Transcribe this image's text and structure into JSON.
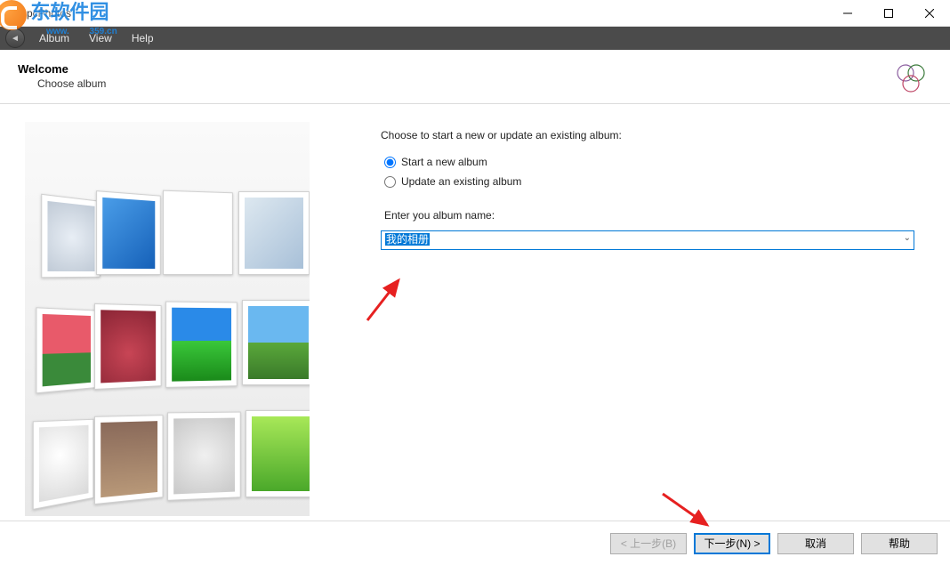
{
  "window": {
    "title": "pcPhotos"
  },
  "menubar": {
    "album": "Album",
    "view": "View",
    "help": "Help"
  },
  "header": {
    "title": "Welcome",
    "subtitle": "Choose album"
  },
  "content": {
    "instruction": "Choose to start a new or update an existing album:",
    "radio_new": "Start a new album",
    "radio_update": "Update an existing album",
    "label_enter": "Enter you album name:",
    "album_value": "我的相册"
  },
  "footer": {
    "back": "< 上一步(B)",
    "next": "下一步(N) >",
    "cancel": "取消",
    "help": "帮助"
  },
  "watermark": {
    "brand": "东软件园",
    "url_fragment": "359.cn"
  }
}
